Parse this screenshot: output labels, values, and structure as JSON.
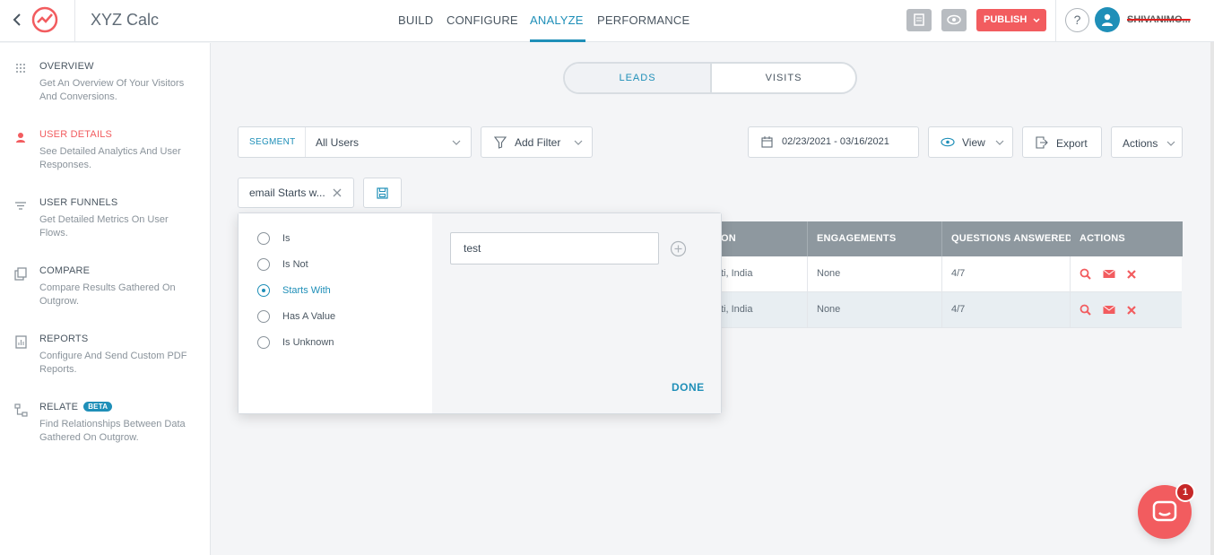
{
  "header": {
    "app_title": "XYZ Calc",
    "nav": [
      "BUILD",
      "CONFIGURE",
      "ANALYZE",
      "PERFORMANCE"
    ],
    "active_nav": "ANALYZE",
    "publish_label": "PUBLISH",
    "help_label": "?",
    "user_name": "SHIVANIMO..."
  },
  "sidebar": {
    "items": [
      {
        "title": "OVERVIEW",
        "desc": "Get An Overview Of Your Visitors And Conversions.",
        "icon": "grid-dots-icon"
      },
      {
        "title": "USER DETAILS",
        "desc": "See Detailed Analytics And User Responses.",
        "icon": "user-icon",
        "active": true
      },
      {
        "title": "USER FUNNELS",
        "desc": "Get Detailed Metrics On User Flows.",
        "icon": "funnel-lines-icon"
      },
      {
        "title": "COMPARE",
        "desc": "Compare Results Gathered On Outgrow.",
        "icon": "compare-icon"
      },
      {
        "title": "REPORTS",
        "desc": "Configure And Send Custom PDF Reports.",
        "icon": "report-icon"
      },
      {
        "title": "RELATE",
        "desc": "Find Relationships Between Data Gathered On Outgrow.",
        "icon": "relate-icon",
        "badge": "BETA"
      }
    ]
  },
  "toggle": {
    "leads": "LEADS",
    "visits": "VISITS",
    "selected": "LEADS"
  },
  "filters": {
    "segment_label": "SEGMENT",
    "segment_value": "All Users",
    "add_filter": "Add Filter",
    "date_range": "02/23/2021 - 03/16/2021",
    "view": "View",
    "export": "Export",
    "actions": "Actions",
    "active_filter_chip": "email Starts w..."
  },
  "table": {
    "headers": [
      "ON",
      "ENGAGEMENTS",
      "QUESTIONS ANSWERED",
      "ACTIONS"
    ],
    "rows": [
      {
        "location": "ti, India",
        "engagements": "None",
        "questions": "4/7"
      },
      {
        "location": "ti, India",
        "engagements": "None",
        "questions": "4/7"
      }
    ]
  },
  "filter_popover": {
    "options": [
      "Is",
      "Is Not",
      "Starts With",
      "Has A Value",
      "Is Unknown"
    ],
    "selected": "Starts With",
    "value": "test",
    "done_label": "DONE"
  },
  "chat": {
    "badge_count": "1"
  },
  "colors": {
    "accent": "#1f8fb8",
    "brand_red": "#f25c5f",
    "header_gray": "#8e989f"
  }
}
